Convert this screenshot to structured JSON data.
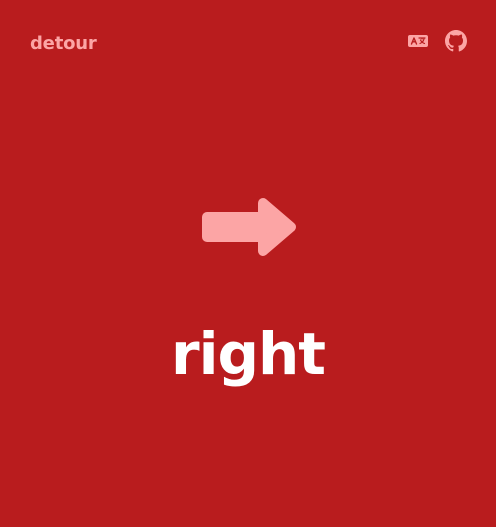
{
  "app": {
    "brand": "detour"
  },
  "header": {
    "icons": [
      "translate-icon",
      "github-icon"
    ]
  },
  "main": {
    "direction_icon": "arrow-right-icon",
    "direction_label": "right"
  },
  "colors": {
    "background": "#b91c1e",
    "brand": "#fca5a5",
    "arrow": "#fca5a5",
    "label": "#ffffff"
  }
}
